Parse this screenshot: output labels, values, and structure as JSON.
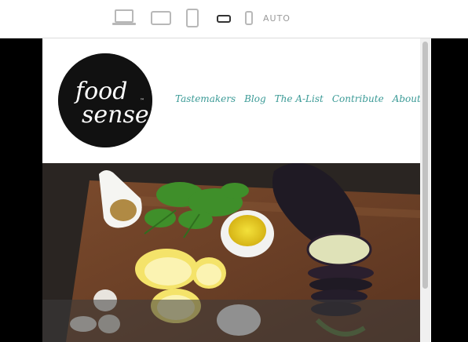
{
  "toolbar": {
    "devices": [
      {
        "icon": "laptop-icon",
        "state": "inactive"
      },
      {
        "icon": "tablet-landscape-icon",
        "state": "inactive"
      },
      {
        "icon": "tablet-portrait-icon",
        "state": "inactive"
      },
      {
        "icon": "phone-landscape-icon",
        "state": "active"
      },
      {
        "icon": "phone-portrait-icon",
        "state": "inactive"
      }
    ],
    "auto_label": "AUTO"
  },
  "site": {
    "logo": {
      "line1": "food",
      "line2": "sense",
      "tm": "™"
    },
    "nav": [
      "Tastemakers",
      "Blog",
      "The A-List",
      "Contribute",
      "About"
    ]
  },
  "colors": {
    "nav": "#3a9a96",
    "logo_bg": "#111111",
    "icon_inactive": "#b8b8b8",
    "icon_active": "#333333"
  }
}
